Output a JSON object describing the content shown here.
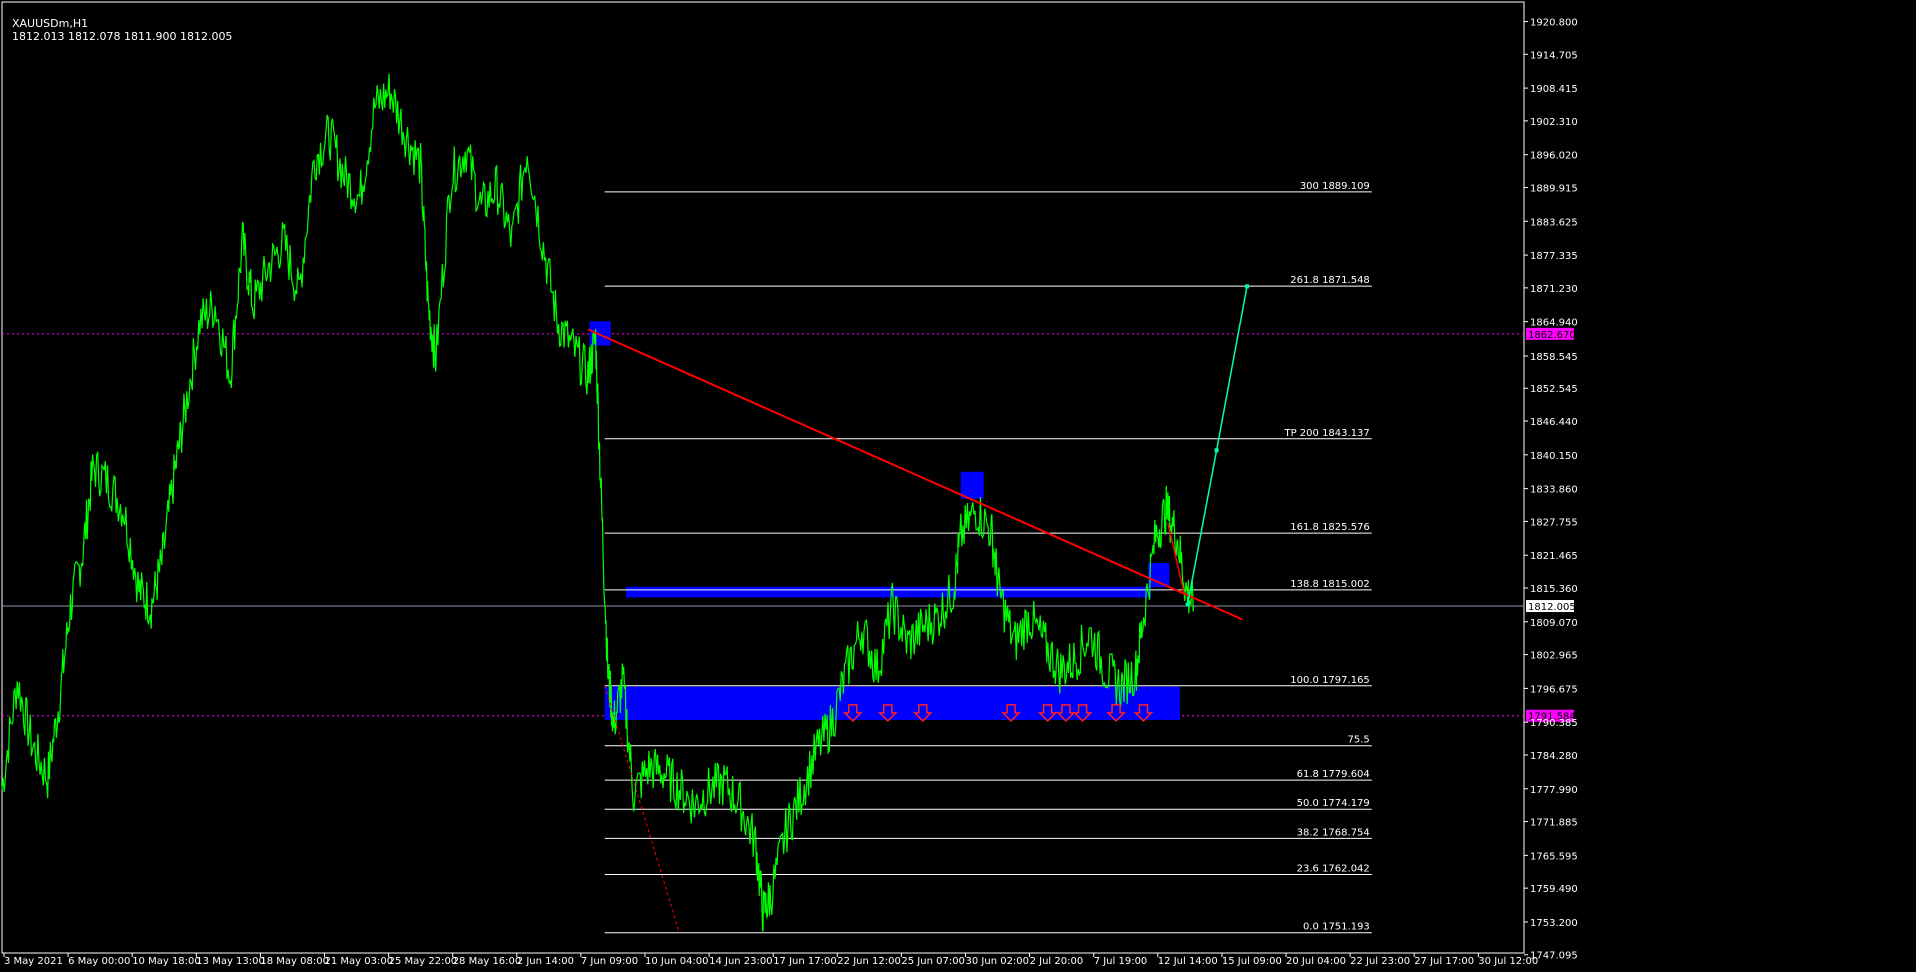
{
  "header": {
    "symbol": "XAUUSDm,H1",
    "ohlc": "1812.013 1812.078 1811.900 1812.005"
  },
  "colors": {
    "background": "#000000",
    "price_line": "#00ff00",
    "trendline": "#ff0000",
    "zones": "#0000ff",
    "projection": "#00ffaa",
    "level_lines": "#ffffff",
    "alert_level": "#ff00ff"
  },
  "chart_data": {
    "type": "line",
    "ylim": [
      1745.0,
      1925.0
    ],
    "price_axis_ticks": [
      "1920.800",
      "1914.705",
      "1908.415",
      "1902.310",
      "1896.020",
      "1889.915",
      "1883.625",
      "1877.335",
      "1871.230",
      "1864.940",
      "1858.545",
      "1852.545",
      "1846.440",
      "1840.150",
      "1833.860",
      "1827.755",
      "1821.465",
      "1815.360",
      "1809.070",
      "1802.965",
      "1796.675",
      "1790.385",
      "1784.280",
      "1777.990",
      "1771.885",
      "1765.595",
      "1759.490",
      "1753.200",
      "1747.095"
    ],
    "time_axis_labels": [
      "3 May 2021",
      "6 May 00:00",
      "10 May 18:00",
      "13 May 13:00",
      "18 May 08:00",
      "21 May 03:00",
      "25 May 22:00",
      "28 May 16:00",
      "2 Jun 14:00",
      "7 Jun 09:00",
      "10 Jun 04:00",
      "14 Jun 23:00",
      "17 Jun 17:00",
      "22 Jun 12:00",
      "25 Jun 07:00",
      "30 Jun 02:00",
      "2 Jul 20:00",
      "7 Jul 19:00",
      "12 Jul 14:00",
      "15 Jul 09:00",
      "20 Jul 04:00",
      "22 Jul 23:00",
      "27 Jul 17:00",
      "30 Jul 12:00"
    ],
    "x_range": [
      0,
      100
    ],
    "price_anchors": [
      [
        0,
        1778
      ],
      [
        1,
        1798
      ],
      [
        2,
        1786
      ],
      [
        3,
        1780
      ],
      [
        3.8,
        1795
      ],
      [
        4.5,
        1812
      ],
      [
        5.3,
        1822
      ],
      [
        6,
        1838
      ],
      [
        7,
        1835
      ],
      [
        8,
        1830
      ],
      [
        9,
        1815
      ],
      [
        9.8,
        1812
      ],
      [
        10.5,
        1820
      ],
      [
        11.3,
        1836
      ],
      [
        12,
        1848
      ],
      [
        13,
        1865
      ],
      [
        14,
        1868
      ],
      [
        15,
        1855
      ],
      [
        15.8,
        1880
      ],
      [
        16.5,
        1868
      ],
      [
        17.5,
        1875
      ],
      [
        18.5,
        1880
      ],
      [
        19.5,
        1870
      ],
      [
        20.5,
        1895
      ],
      [
        21.5,
        1900
      ],
      [
        22.5,
        1892
      ],
      [
        23.5,
        1888
      ],
      [
        24.5,
        1905
      ],
      [
        25.5,
        1908
      ],
      [
        26.5,
        1900
      ],
      [
        27.5,
        1894
      ],
      [
        28,
        1868
      ],
      [
        28.5,
        1858
      ],
      [
        29.5,
        1892
      ],
      [
        30.5,
        1897
      ],
      [
        31.5,
        1886
      ],
      [
        32.5,
        1890
      ],
      [
        33.5,
        1880
      ],
      [
        34.5,
        1897
      ],
      [
        35.5,
        1880
      ],
      [
        36.5,
        1865
      ],
      [
        37.5,
        1860
      ],
      [
        38.5,
        1855
      ],
      [
        39,
        1862
      ],
      [
        39.4,
        1830
      ],
      [
        39.8,
        1800
      ],
      [
        40.2,
        1790
      ],
      [
        40.8,
        1798
      ],
      [
        41.5,
        1777
      ],
      [
        42.5,
        1782
      ],
      [
        43.5,
        1781
      ],
      [
        44.5,
        1778
      ],
      [
        45.5,
        1775
      ],
      [
        46.5,
        1778
      ],
      [
        47.5,
        1779
      ],
      [
        48.5,
        1775
      ],
      [
        49.5,
        1768
      ],
      [
        50,
        1755
      ],
      [
        50.5,
        1758
      ],
      [
        51.5,
        1770
      ],
      [
        52.5,
        1777
      ],
      [
        53.5,
        1785
      ],
      [
        54.5,
        1790
      ],
      [
        55.5,
        1800
      ],
      [
        56.5,
        1808
      ],
      [
        57.5,
        1800
      ],
      [
        58.5,
        1812
      ],
      [
        59.5,
        1805
      ],
      [
        60.5,
        1808
      ],
      [
        61.5,
        1810
      ],
      [
        62.5,
        1815
      ],
      [
        63,
        1825
      ],
      [
        64,
        1830
      ],
      [
        65,
        1826
      ],
      [
        65.5,
        1815
      ],
      [
        66.5,
        1805
      ],
      [
        67.5,
        1810
      ],
      [
        68.5,
        1805
      ],
      [
        69.5,
        1800
      ],
      [
        70.5,
        1802
      ],
      [
        71.5,
        1807
      ],
      [
        72.5,
        1800
      ],
      [
        73.5,
        1797
      ],
      [
        74.5,
        1800
      ],
      [
        75,
        1810
      ],
      [
        75.8,
        1825
      ],
      [
        76.5,
        1830
      ],
      [
        77.2,
        1825
      ],
      [
        77.8,
        1815
      ],
      [
        78.3,
        1812
      ]
    ],
    "trendline": {
      "x1": 38.5,
      "y1": 1863.5,
      "x2": 81.5,
      "y2": 1809.5
    },
    "dashed_line": {
      "x1": 39.6,
      "y1": 1797.2,
      "x2": 44.5,
      "y2": 1751.2
    },
    "red_small": {
      "x1": 76.6,
      "y1": 1827.5,
      "x2": 77.7,
      "y2": 1814.0
    },
    "projection": [
      [
        77.9,
        1812.3
      ],
      [
        79.8,
        1841.0
      ],
      [
        81.8,
        1871.5
      ]
    ],
    "levels": [
      {
        "label": "300 1889.109",
        "price": 1889.109
      },
      {
        "label": "261.8 1871.548",
        "price": 1871.548
      },
      {
        "label": "TP 200 1843.137",
        "price": 1843.137
      },
      {
        "label": "161.8 1825.576",
        "price": 1825.576
      },
      {
        "label": "138.8 1815.002",
        "price": 1815.002
      },
      {
        "label": "100.0 1797.165",
        "price": 1797.165
      },
      {
        "label": "75.5",
        "price": 1786.0
      },
      {
        "label": "61.8 1779.604",
        "price": 1779.604
      },
      {
        "label": "50.0 1774.179",
        "price": 1774.179
      },
      {
        "label": "38.2 1768.754",
        "price": 1768.754
      },
      {
        "label": "23.6 1762.042",
        "price": 1762.042
      },
      {
        "label": "0.0 1751.193",
        "price": 1751.193
      }
    ],
    "levels_x_range": [
      39.6,
      90.0
    ],
    "current_price_label": "1812.005",
    "current_price": 1812.005,
    "alert_levels": [
      {
        "label": "1862.670",
        "price": 1862.67
      },
      {
        "label": "1791.584",
        "price": 1791.584
      }
    ],
    "zones": [
      {
        "x0": 39.6,
        "x1": 77.4,
        "p_top": 1797.0,
        "p_bot": 1790.8
      },
      {
        "x0": 41.0,
        "x1": 75.5,
        "p_top": 1815.6,
        "p_bot": 1813.6
      },
      {
        "x0": 38.6,
        "x1": 40.0,
        "p_top": 1865.0,
        "p_bot": 1860.5
      },
      {
        "x0": 63.0,
        "x1": 64.5,
        "p_top": 1837.0,
        "p_bot": 1832.0
      },
      {
        "x0": 75.3,
        "x1": 76.7,
        "p_top": 1820.0,
        "p_bot": 1815.5
      }
    ],
    "down_arrows_x": [
      55.9,
      58.2,
      60.5,
      66.3,
      68.7,
      69.9,
      71.0,
      73.2,
      75.0
    ]
  }
}
